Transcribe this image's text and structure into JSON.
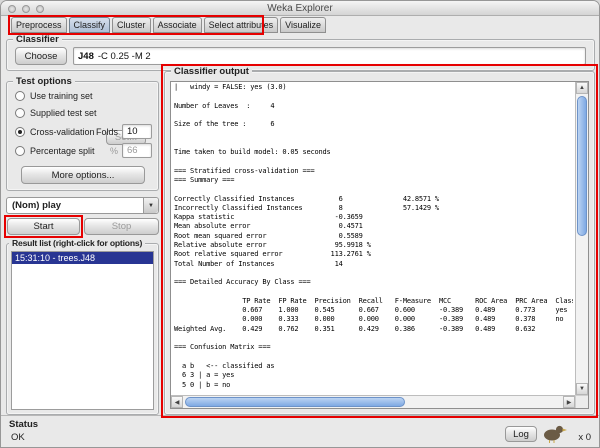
{
  "window": {
    "title": "Weka Explorer"
  },
  "tabs": [
    {
      "label": "Preprocess",
      "selected": false
    },
    {
      "label": "Classify",
      "selected": true
    },
    {
      "label": "Cluster",
      "selected": false
    },
    {
      "label": "Associate",
      "selected": false
    },
    {
      "label": "Select attributes",
      "selected": false
    },
    {
      "label": "Visualize",
      "selected": false
    }
  ],
  "classifier": {
    "legend": "Classifier",
    "choose_label": "Choose",
    "name": "J48",
    "params": "-C 0.25 -M 2"
  },
  "test_options": {
    "legend": "Test options",
    "radio_training": {
      "label": "Use training set",
      "selected": false
    },
    "radio_supplied": {
      "label": "Supplied test set",
      "selected": false,
      "button_label": "Set..."
    },
    "radio_cv": {
      "label": "Cross-validation",
      "selected": true,
      "field_label": "Folds",
      "value": "10"
    },
    "radio_split": {
      "label": "Percentage split",
      "selected": false,
      "field_label": "%",
      "value": "66"
    },
    "more_options_label": "More options..."
  },
  "class_attribute": {
    "value": "(Nom) play"
  },
  "actions": {
    "start_label": "Start",
    "stop_label": "Stop"
  },
  "result_list": {
    "legend": "Result list (right-click for options)",
    "items": [
      {
        "label": "15:31:10 - trees.J48",
        "selected": true
      }
    ]
  },
  "classifier_output": {
    "legend": "Classifier output",
    "lines": [
      "|   windy = FALSE: yes (3.0)",
      "",
      "Number of Leaves  :     4",
      "",
      "Size of the tree :      6",
      "",
      "",
      "Time taken to build model: 0.05 seconds",
      "",
      "=== Stratified cross-validation ===",
      "=== Summary ===",
      "",
      "Correctly Classified Instances           6               42.8571 %",
      "Incorrectly Classified Instances         8               57.1429 %",
      "Kappa statistic                         -0.3659",
      "Mean absolute error                      0.4571",
      "Root mean squared error                  0.5589",
      "Relative absolute error                 95.9918 %",
      "Root relative squared error            113.2761 %",
      "Total Number of Instances               14",
      "",
      "=== Detailed Accuracy By Class ===",
      "",
      "                 TP Rate  FP Rate  Precision  Recall   F-Measure  MCC      ROC Area  PRC Area  Class",
      "                 0.667    1.000    0.545      0.667    0.600      -0.389   0.489     0.773     yes",
      "                 0.000    0.333    0.000      0.000    0.000      -0.389   0.489     0.378     no",
      "Weighted Avg.    0.429    0.762    0.351      0.429    0.386      -0.389   0.489     0.632",
      "",
      "=== Confusion Matrix ===",
      "",
      "  a b   <-- classified as",
      "  6 3 | a = yes",
      "  5 0 | b = no"
    ]
  },
  "status_bar": {
    "legend": "Status",
    "message": "OK",
    "log_label": "Log",
    "process_counter": "x 0"
  },
  "colors": {
    "annotation_red": "#e60000",
    "selection_blue": "#283593"
  }
}
